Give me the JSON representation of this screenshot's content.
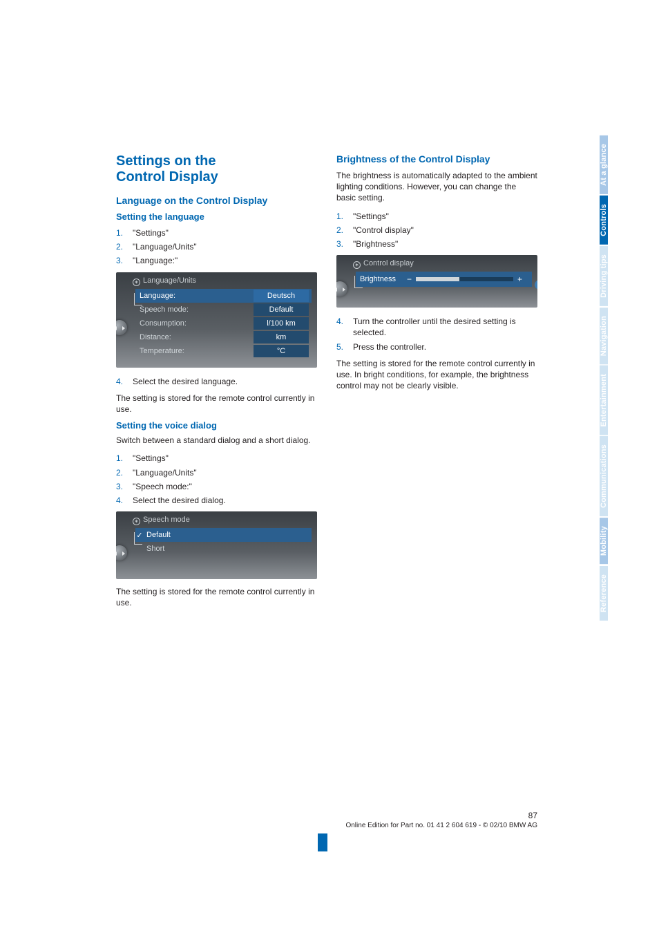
{
  "tabs": {
    "glance": "At a glance",
    "controls": "Controls",
    "driving": "Driving tips",
    "nav": "Navigation",
    "ent": "Entertainment",
    "comm": "Communications",
    "mob": "Mobility",
    "ref": "Reference"
  },
  "left": {
    "h1a": "Settings on the",
    "h1b": "Control Display",
    "lang_h2": "Language on the Control Display",
    "setlang_h3": "Setting the language",
    "setlang_steps": [
      "\"Settings\"",
      "\"Language/Units\"",
      "\"Language:\""
    ],
    "shot1": {
      "title": "Language/Units",
      "rows": [
        {
          "lab": "Language:",
          "val": "Deutsch",
          "sel": true
        },
        {
          "lab": "Speech mode:",
          "val": "Default"
        },
        {
          "lab": "Consumption:",
          "val": "l/100 km"
        },
        {
          "lab": "Distance:",
          "val": "km"
        },
        {
          "lab": "Temperature:",
          "val": "°C"
        }
      ]
    },
    "setlang_step4": "Select the desired language.",
    "setlang_after": "The setting is stored for the remote control currently in use.",
    "voice_h3": "Setting the voice dialog",
    "voice_intro": "Switch between a standard dialog and a short dialog.",
    "voice_steps": [
      "\"Settings\"",
      "\"Language/Units\"",
      "\"Speech mode:\"",
      "Select the desired dialog."
    ],
    "shot2": {
      "title": "Speech mode",
      "rows": [
        {
          "lab": "Default",
          "sel": true,
          "check": true
        },
        {
          "lab": "Short"
        }
      ]
    },
    "voice_after": "The setting is stored for the remote control currently in use."
  },
  "right": {
    "bri_h2": "Brightness of the Control Display",
    "bri_intro": "The brightness is automatically adapted to the ambient lighting conditions. However, you can change the basic setting.",
    "bri_steps": [
      "\"Settings\"",
      "\"Control display\"",
      "\"Brightness\""
    ],
    "shot3": {
      "title": "Control display",
      "row_label": "Brightness"
    },
    "bri_step4": "Turn the controller until the desired setting is selected.",
    "bri_step5": "Press the controller.",
    "bri_after": "The setting is stored for the remote control currently in use. In bright conditions, for example, the brightness control may not be clearly visible."
  },
  "footer": {
    "page": "87",
    "line": "Online Edition for Part no. 01 41 2 604 619 - © 02/10 BMW AG"
  }
}
